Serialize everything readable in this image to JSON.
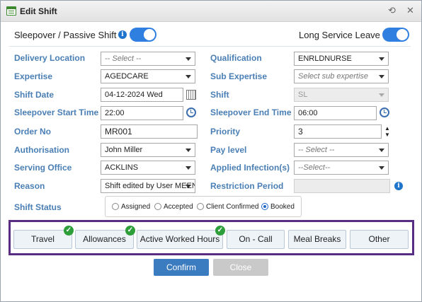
{
  "window": {
    "title": "Edit Shift",
    "refresh_icon": "refresh-icon",
    "close_icon": "✕"
  },
  "toggles": {
    "sleepover_label": "Sleepover / Passive Shift ?",
    "sleepover_on": true,
    "long_service_label": "Long Service Leave ?",
    "long_service_on": true
  },
  "form": {
    "delivery_location": {
      "label": "Delivery Location",
      "value": "-- Select --"
    },
    "qualification": {
      "label": "Qualification",
      "value": "ENRLDNURSE"
    },
    "expertise": {
      "label": "Expertise",
      "value": "AGEDCARE"
    },
    "sub_expertise": {
      "label": "Sub Expertise",
      "placeholder": "Select sub expertise"
    },
    "shift_date": {
      "label": "Shift Date",
      "value": "04-12-2024 Wed"
    },
    "shift": {
      "label": "Shift",
      "value": "SL"
    },
    "sleepover_start": {
      "label": "Sleepover Start Time",
      "value": "22:00"
    },
    "sleepover_end": {
      "label": "Sleepover End Time",
      "value": "06:00"
    },
    "order_no": {
      "label": "Order No",
      "value": "MR001"
    },
    "priority": {
      "label": "Priority",
      "value": "3"
    },
    "authorisation": {
      "label": "Authorisation",
      "value": "John Miller"
    },
    "pay_level": {
      "label": "Pay level",
      "value": "-- Select --"
    },
    "serving_office": {
      "label": "Serving Office",
      "value": "ACKLINS"
    },
    "applied_infections": {
      "label": "Applied Infection(s)",
      "value": "--Select--"
    },
    "reason": {
      "label": "Reason",
      "value": "Shift edited by User MEEN"
    },
    "restriction_period": {
      "label": "Restriction Period",
      "value": ""
    },
    "shift_status": {
      "label": "Shift Status",
      "options": [
        "Assigned",
        "Accepted",
        "Client Confirmed",
        "Booked"
      ],
      "selected": "Booked"
    }
  },
  "tabs": [
    {
      "label": "Travel",
      "checked": true
    },
    {
      "label": "Allowances",
      "checked": true
    },
    {
      "label": "Active Worked Hours",
      "checked": true
    },
    {
      "label": "On - Call",
      "checked": false
    },
    {
      "label": "Meal Breaks",
      "checked": false
    },
    {
      "label": "Other",
      "checked": false
    }
  ],
  "actions": {
    "confirm": "Confirm",
    "close": "Close"
  },
  "colors": {
    "label_blue": "#4a7fb5",
    "toggle_blue": "#2f7fe0",
    "confirm_blue": "#3b7bbf",
    "check_green": "#2e9e3a",
    "frame_purple": "#5a2d82"
  },
  "icons": {
    "check": "✓",
    "info": "i"
  }
}
